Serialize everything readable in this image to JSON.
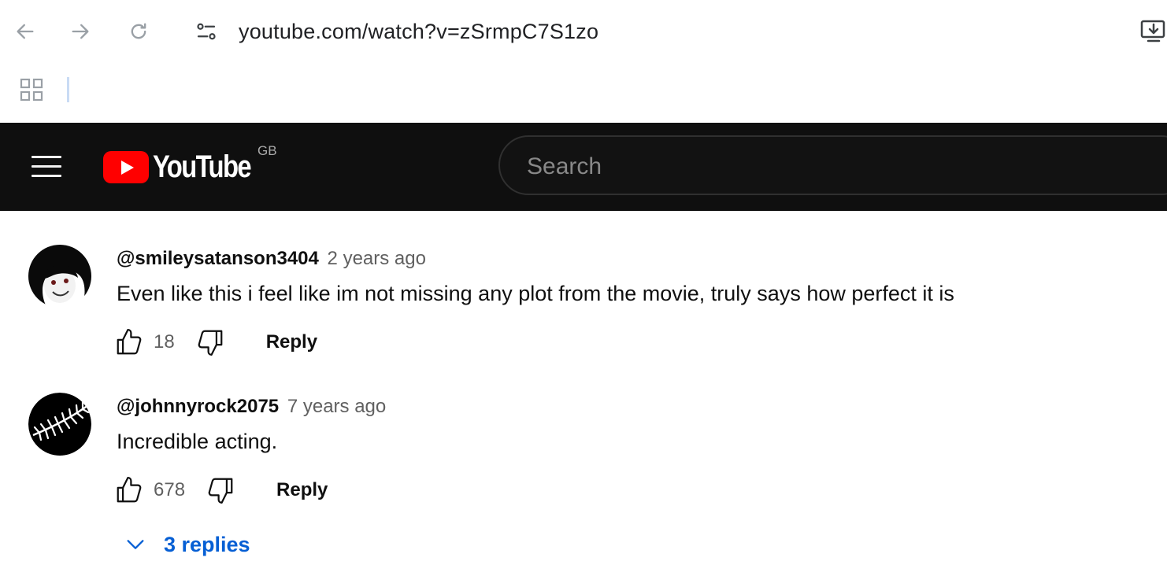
{
  "browser": {
    "url": "youtube.com/watch?v=zSrmpC7S1zo"
  },
  "masthead": {
    "logo_text": "YouTube",
    "country_code": "GB",
    "search_placeholder": "Search"
  },
  "comments": [
    {
      "author": "@smileysatanson3404",
      "time": "2 years ago",
      "text": "Even like this i feel like im not missing any plot from the movie, truly says how perfect it is",
      "likes": "18",
      "reply_label": "Reply"
    },
    {
      "author": "@johnnyrock2075",
      "time": "7 years ago",
      "text": "Incredible acting.",
      "likes": "678",
      "reply_label": "Reply",
      "replies_label": "3 replies"
    }
  ],
  "colors": {
    "masthead_bg": "#0f0f0f",
    "brand_red": "#ff0000",
    "link_blue": "#065fd4"
  }
}
